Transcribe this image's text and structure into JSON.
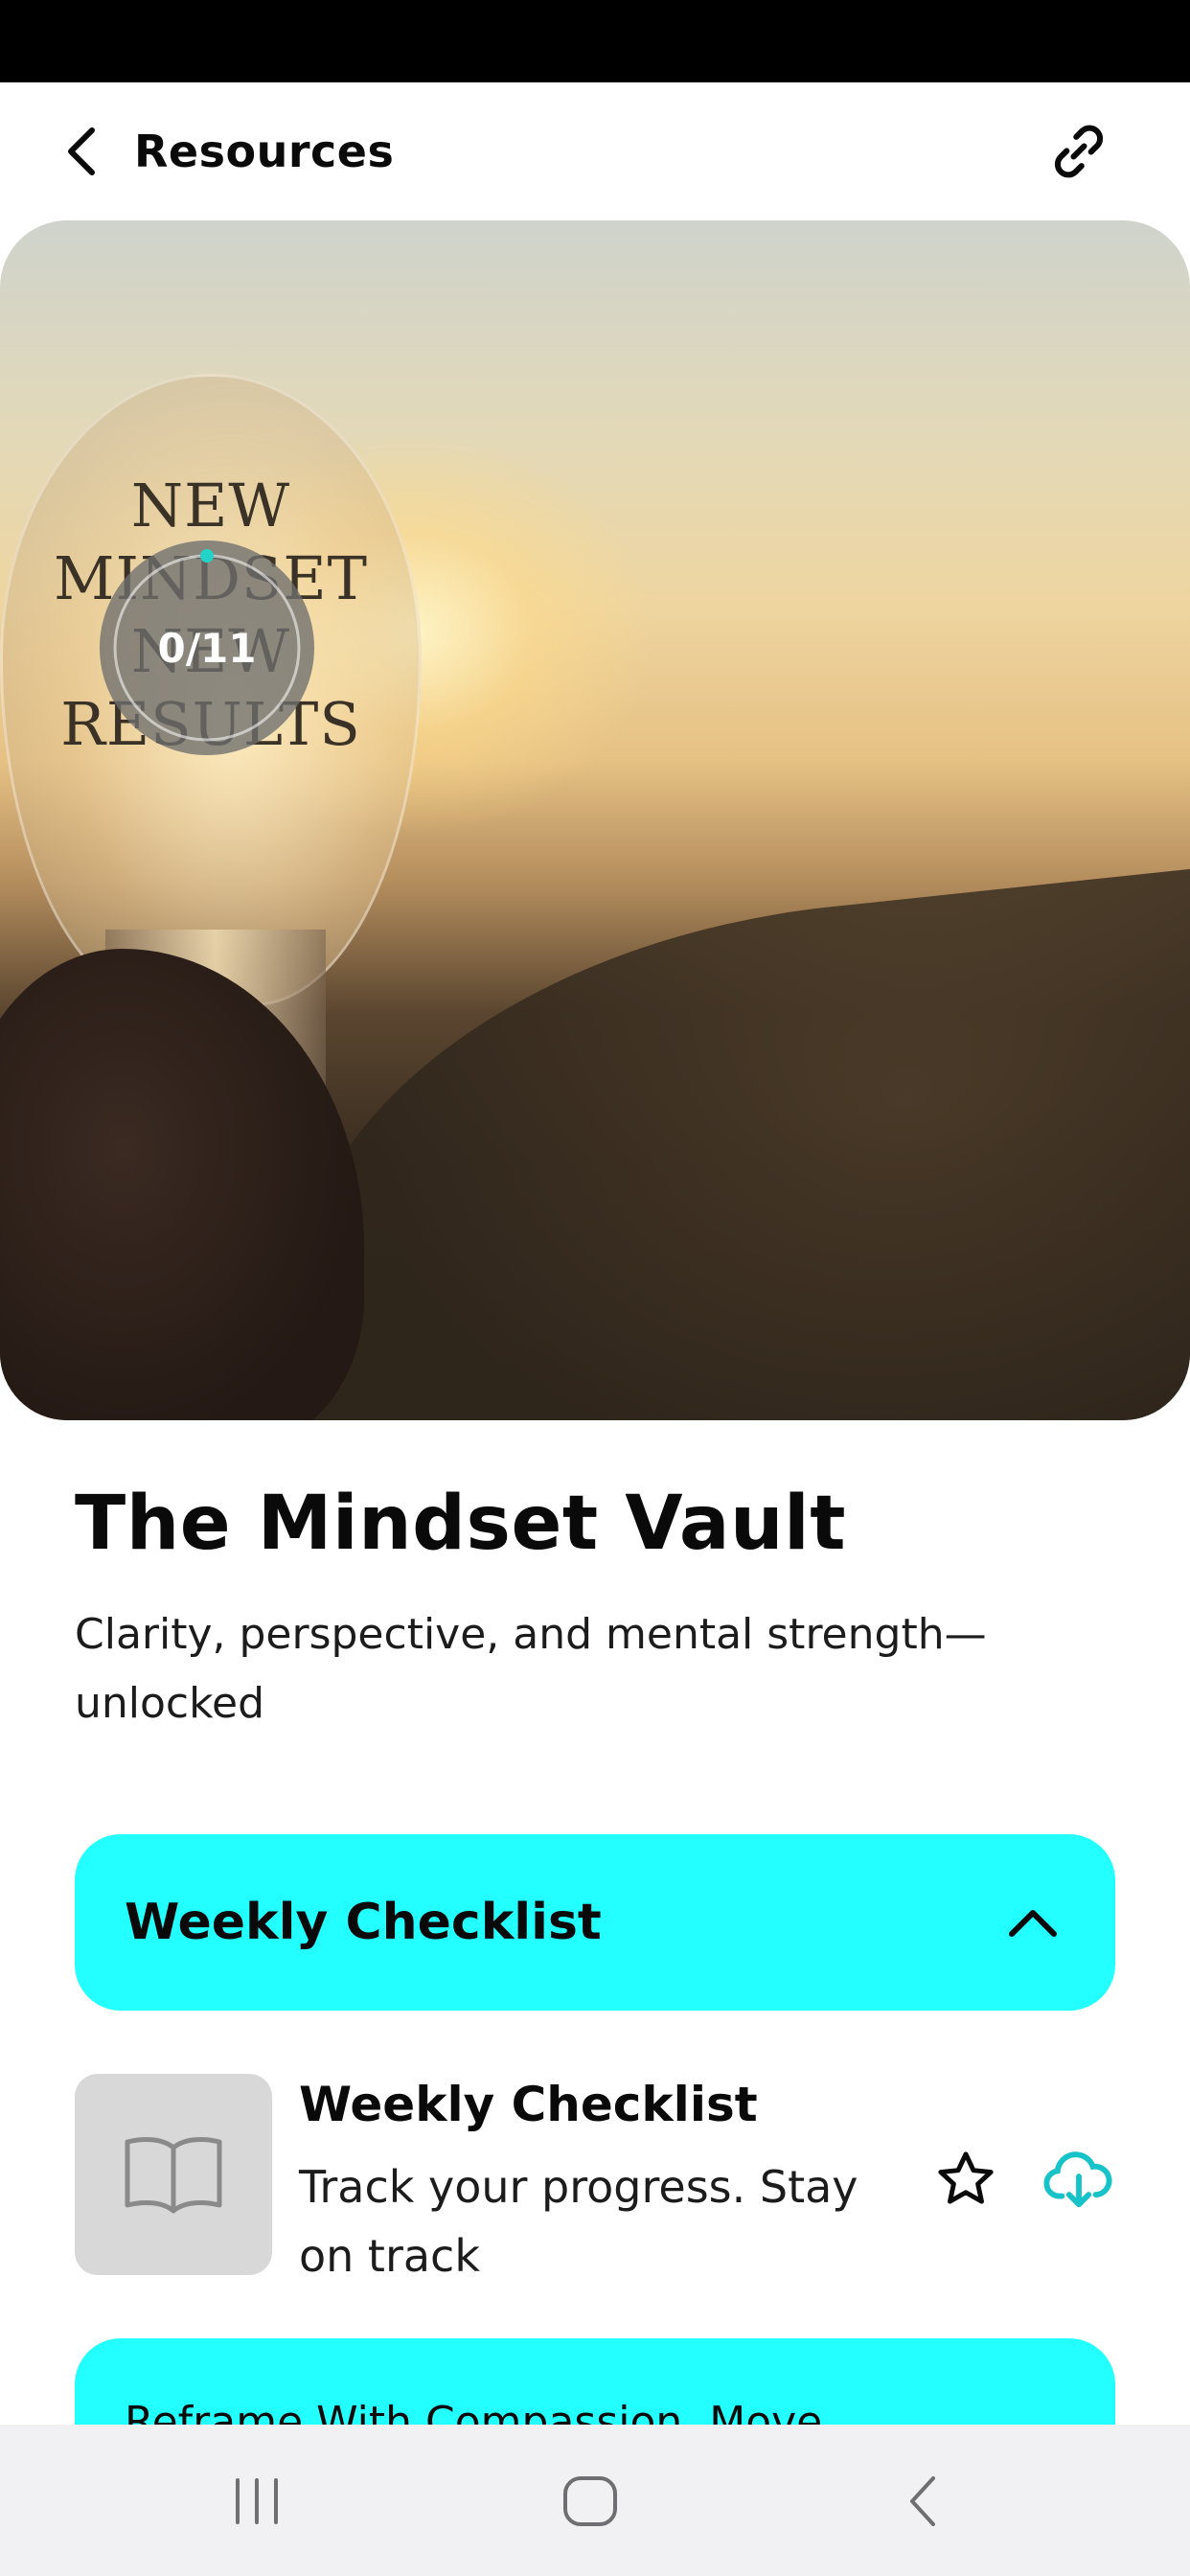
{
  "header": {
    "title": "Resources",
    "back_icon": "chevron-left-icon",
    "share_icon": "link-icon"
  },
  "hero": {
    "image_text": [
      "NEW",
      "MINDSET",
      "NEW",
      "RESULTS"
    ],
    "progress_label": "0/11",
    "progress_completed": 0,
    "progress_total": 11
  },
  "title": "The Mindset Vault",
  "subtitle": "Clarity, perspective, and mental strength—unlocked",
  "accordion": {
    "label": "Weekly Checklist",
    "state": "expanded",
    "icon": "chevron-up-icon"
  },
  "items": [
    {
      "title": "Weekly Checklist",
      "description": "Track your progress. Stay on track",
      "thumb_icon": "book-icon",
      "favorite_icon": "star-icon",
      "download_icon": "cloud-download-icon"
    }
  ],
  "next_accordion": {
    "label": "Reframe With Compassion. Move"
  },
  "nav": {
    "recents_icon": "recents-icon",
    "home_icon": "home-icon",
    "back_icon": "back-icon"
  },
  "colors": {
    "accent": "#23FFFF",
    "download_icon": "#16C3C8",
    "progress_dot": "#22D3C8"
  }
}
